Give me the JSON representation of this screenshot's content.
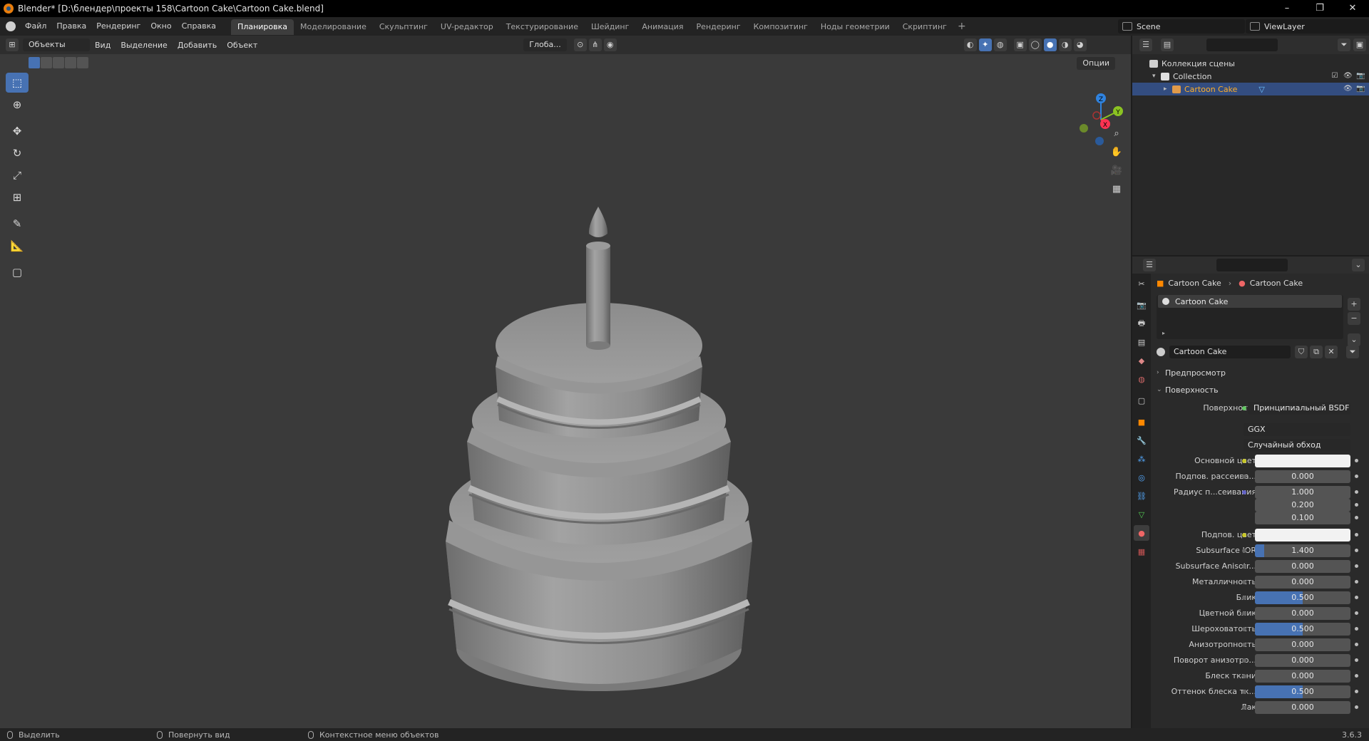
{
  "window": {
    "title": "Blender* [D:\\блендер\\проекты 158\\Cartoon Cake\\Cartoon Cake.blend]",
    "min": "–",
    "max": "❐",
    "close": "✕"
  },
  "menu": [
    "Файл",
    "Правка",
    "Рендеринг",
    "Окно",
    "Справка"
  ],
  "workspaces": [
    "Планировка",
    "Моделирование",
    "Скульптинг",
    "UV-редактор",
    "Текстурирование",
    "Шейдинг",
    "Анимация",
    "Рендеринг",
    "Композитинг",
    "Ноды геометрии",
    "Скриптинг"
  ],
  "workspace_add": "+",
  "scene": "Scene",
  "view_layer": "ViewLayer",
  "viewport": {
    "mode": "Объекты",
    "menus": [
      "Вид",
      "Выделение",
      "Добавить",
      "Объект"
    ],
    "transform": "Глоба...",
    "options": "Опции",
    "gizmo": {
      "x": "X",
      "y": "Y",
      "z": "Z"
    }
  },
  "outliner": {
    "scene_collection": "Коллекция сцены",
    "collection": "Collection",
    "object": "Cartoon Cake"
  },
  "properties": {
    "breadcrumb_object": "Cartoon Cake",
    "breadcrumb_material": "Cartoon Cake",
    "slot": "Cartoon Cake",
    "material_name": "Cartoon Cake",
    "preview_panel": "Предпросмотр",
    "surface_panel": "Поверхность",
    "surface_label": "Поверхность",
    "surface_shader": "Принципиальный BSDF",
    "distribution": "GGX",
    "subsurface_method": "Случайный обход",
    "rows": [
      {
        "label": "Основной цвет",
        "value": "",
        "kind": "white",
        "dot": "y"
      },
      {
        "label": "Подпов. рассеива...",
        "value": "0.000",
        "fill": 0,
        "dot": "n"
      },
      {
        "label": "Радиус п...сеивания",
        "value": "1.000",
        "fill": 0,
        "dot": "p"
      },
      {
        "label": "",
        "value": "0.200",
        "fill": 0,
        "dot": "none"
      },
      {
        "label": "",
        "value": "0.100",
        "fill": 0,
        "dot": "none"
      },
      {
        "label": "Подпов. цвет",
        "value": "",
        "kind": "white",
        "dot": "y"
      },
      {
        "label": "Subsurface IOR",
        "value": "1.400",
        "fill": 0.1,
        "dot": "n"
      },
      {
        "label": "Subsurface Anisotr...",
        "value": "0.000",
        "fill": 0,
        "dot": "n"
      },
      {
        "label": "Металличность",
        "value": "0.000",
        "fill": 0,
        "dot": "n"
      },
      {
        "label": "Блик",
        "value": "0.500",
        "fill": 0.5,
        "dot": "n"
      },
      {
        "label": "Цветной блик",
        "value": "0.000",
        "fill": 0,
        "dot": "n"
      },
      {
        "label": "Шероховатость",
        "value": "0.500",
        "fill": 0.5,
        "dot": "n"
      },
      {
        "label": "Анизотропность",
        "value": "0.000",
        "fill": 0,
        "dot": "n"
      },
      {
        "label": "Поворот анизотро...",
        "value": "0.000",
        "fill": 0,
        "dot": "n"
      },
      {
        "label": "Блеск ткани",
        "value": "0.000",
        "fill": 0,
        "dot": "n"
      },
      {
        "label": "Оттенок блеска тк...",
        "value": "0.500",
        "fill": 0.5,
        "dot": "n"
      },
      {
        "label": "Лак",
        "value": "0.000",
        "fill": 0,
        "dot": "n"
      }
    ]
  },
  "status": {
    "select": "Выделить",
    "rotate": "Повернуть вид",
    "context": "Контекстное меню объектов",
    "version": "3.6.3"
  },
  "colors": {
    "accent": "#4772b3",
    "selection": "#334d80",
    "viewport_bg": "#3a3a3a"
  }
}
